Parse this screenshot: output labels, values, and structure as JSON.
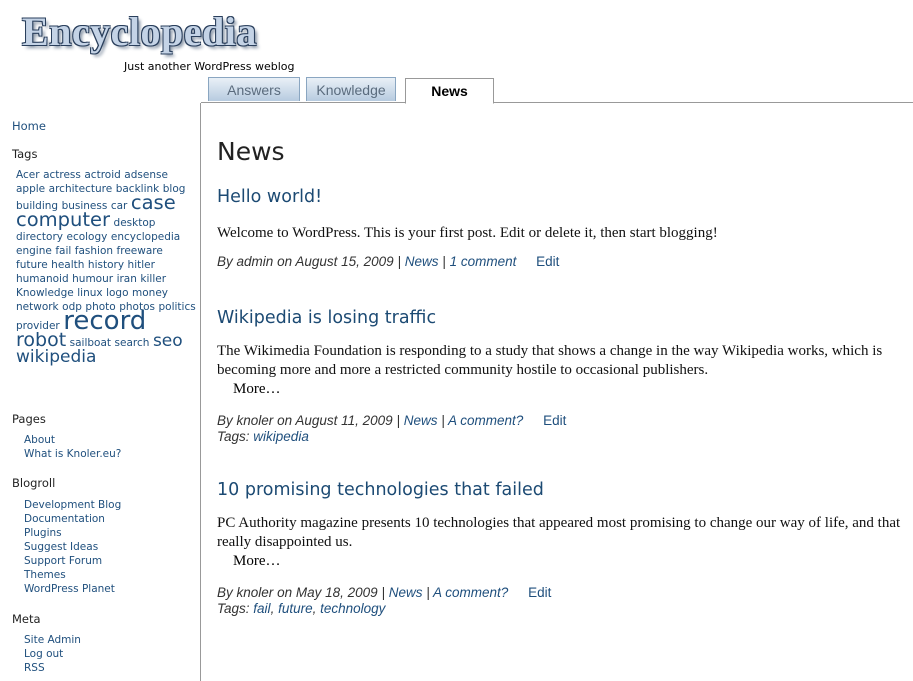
{
  "site": {
    "title": "Encyclopedia",
    "tagline": "Just another WordPress weblog"
  },
  "tabs": [
    {
      "label": "Answers",
      "active": false
    },
    {
      "label": "Knowledge",
      "active": false
    },
    {
      "label": "News",
      "active": true
    }
  ],
  "sidebar": {
    "home": "Home",
    "tags_heading": "Tags",
    "tag_cloud": [
      {
        "label": "Acer",
        "size": "s"
      },
      {
        "label": "actress",
        "size": "s"
      },
      {
        "label": "actroid",
        "size": "s"
      },
      {
        "label": "adsense",
        "size": "s"
      },
      {
        "label": "apple",
        "size": "s"
      },
      {
        "label": "architecture",
        "size": "s"
      },
      {
        "label": "backlink",
        "size": "s"
      },
      {
        "label": "blog",
        "size": "s"
      },
      {
        "label": "building",
        "size": "s"
      },
      {
        "label": "business",
        "size": "s"
      },
      {
        "label": "car",
        "size": "s"
      },
      {
        "label": "case",
        "size": "l"
      },
      {
        "label": "computer",
        "size": "l"
      },
      {
        "label": "desktop",
        "size": "s"
      },
      {
        "label": "directory",
        "size": "s"
      },
      {
        "label": "ecology",
        "size": "s"
      },
      {
        "label": "encyclopedia",
        "size": "s"
      },
      {
        "label": "engine",
        "size": "s"
      },
      {
        "label": "fail",
        "size": "s"
      },
      {
        "label": "fashion",
        "size": "s"
      },
      {
        "label": "freeware",
        "size": "s"
      },
      {
        "label": "future",
        "size": "s"
      },
      {
        "label": "health",
        "size": "s"
      },
      {
        "label": "history",
        "size": "s"
      },
      {
        "label": "hitler",
        "size": "s"
      },
      {
        "label": "humanoid",
        "size": "s"
      },
      {
        "label": "humour",
        "size": "s"
      },
      {
        "label": "iran",
        "size": "s"
      },
      {
        "label": "killer",
        "size": "s"
      },
      {
        "label": "Knowledge",
        "size": "s"
      },
      {
        "label": "linux",
        "size": "s"
      },
      {
        "label": "logo",
        "size": "s"
      },
      {
        "label": "money",
        "size": "s"
      },
      {
        "label": "network",
        "size": "s"
      },
      {
        "label": "odp",
        "size": "s"
      },
      {
        "label": "photo",
        "size": "s"
      },
      {
        "label": "photos",
        "size": "s"
      },
      {
        "label": "politics",
        "size": "s"
      },
      {
        "label": "provider",
        "size": "s"
      },
      {
        "label": "record",
        "size": "xl"
      },
      {
        "label": "robot",
        "size": "ml"
      },
      {
        "label": "sailboat",
        "size": "s"
      },
      {
        "label": "search",
        "size": "s"
      },
      {
        "label": "seo",
        "size": "m"
      },
      {
        "label": "wikipedia",
        "size": "m"
      }
    ],
    "pages_heading": "Pages",
    "pages": [
      "About",
      "What is Knoler.eu?"
    ],
    "blogroll_heading": "Blogroll",
    "blogroll": [
      "Development Blog",
      "Documentation",
      "Plugins",
      "Suggest Ideas",
      "Support Forum",
      "Themes",
      "WordPress Planet"
    ],
    "meta_heading": "Meta",
    "meta": [
      "Site Admin",
      "Log out",
      "RSS"
    ]
  },
  "main": {
    "heading": "News",
    "posts": [
      {
        "title": "Hello world!",
        "body": "Welcome to WordPress. This is your first post. Edit or delete it, then start blogging!",
        "more": "",
        "author": "admin",
        "date": "August 15, 2009",
        "category": "News",
        "comments": "1 comment",
        "edit": "Edit",
        "tags": []
      },
      {
        "title": "Wikipedia is losing traffic",
        "body": "The Wikimedia Foundation is responding to a study that shows a change in the way Wikipedia works, which is becoming more and more a restricted community hostile to occasional publishers.",
        "more": "More…",
        "author": "knoler",
        "date": "August 11, 2009",
        "category": "News",
        "comments": "A comment?",
        "edit": "Edit",
        "tags": [
          "wikipedia"
        ]
      },
      {
        "title": "10 promising technologies that failed",
        "body": "PC Authority magazine presents 10 technologies that appeared most promising to change our way of life, and that really disappointed us.",
        "more": "More…",
        "author": "knoler",
        "date": "May 18, 2009",
        "category": "News",
        "comments": "A comment?",
        "edit": "Edit",
        "tags": [
          "fail",
          "future",
          "technology"
        ]
      }
    ]
  },
  "labels": {
    "by": "By",
    "on": "on",
    "sep": "|",
    "tags_prefix": "Tags:"
  },
  "colors": {
    "link": "#1f4f7d",
    "title": "#1c4a73",
    "tab_bg": "#b7cbe0"
  }
}
